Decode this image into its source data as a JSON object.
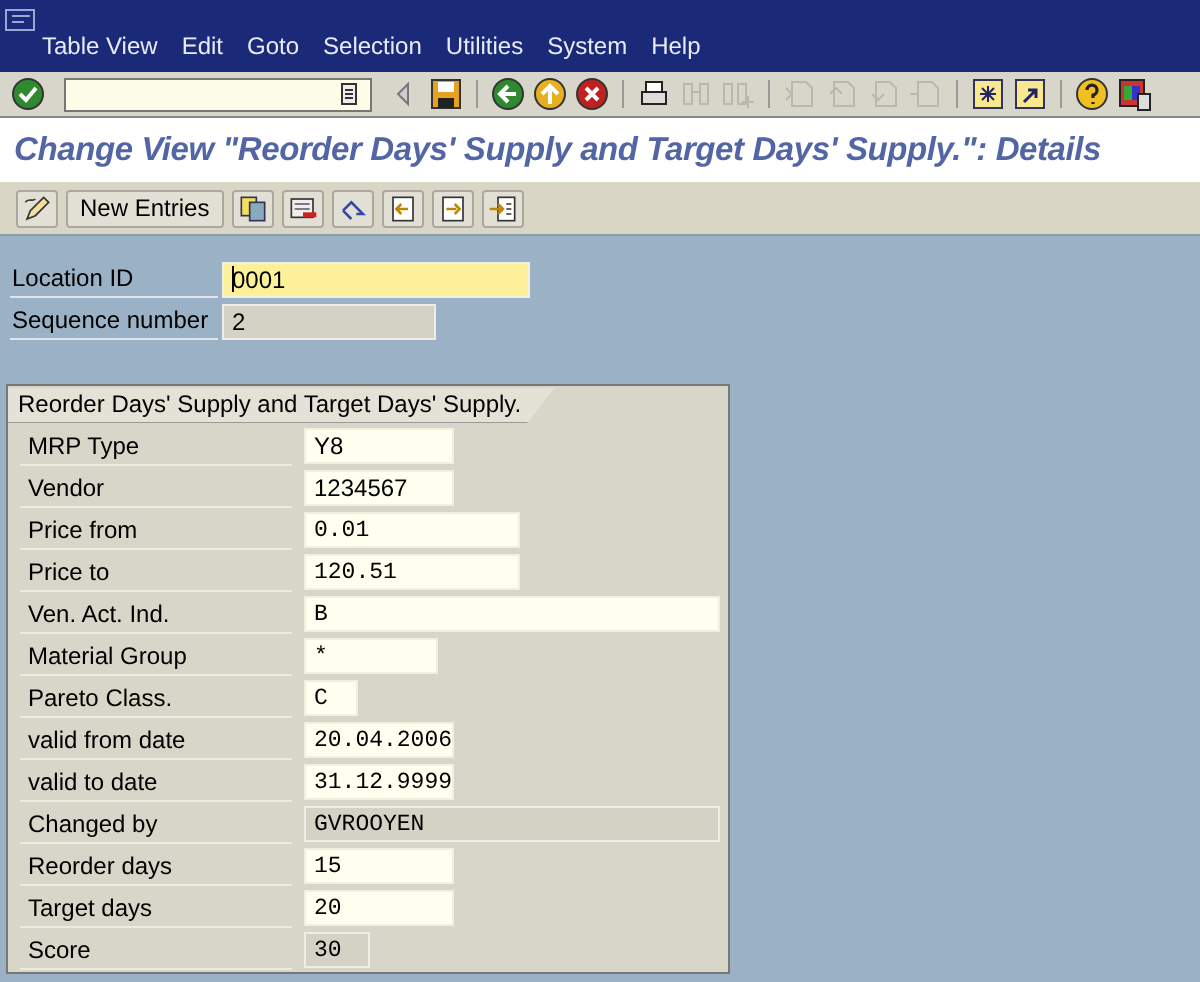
{
  "menu_bar": {
    "items": [
      "Table View",
      "Edit",
      "Goto",
      "Selection",
      "Utilities",
      "System",
      "Help"
    ]
  },
  "title": "Change View \"Reorder Days' Supply and Target Days' Supply.\": Details",
  "app_toolbar": {
    "button": "New Entries"
  },
  "key_fields": [
    {
      "label": "Location ID",
      "value": "0001",
      "kind": "input",
      "focused": true
    },
    {
      "label": "Sequence number",
      "value": "2",
      "kind": "display",
      "focused": false
    }
  ],
  "group": {
    "title": "Reorder Days' Supply and Target Days' Supply.",
    "fields": [
      {
        "label": "MRP Type",
        "value": "Y8",
        "kind": "input"
      },
      {
        "label": "Vendor",
        "value": "1234567",
        "kind": "input"
      },
      {
        "label": "Price from",
        "value": "0.01",
        "kind": "input"
      },
      {
        "label": "Price to",
        "value": "120.51",
        "kind": "input"
      },
      {
        "label": "Ven. Act. Ind.",
        "value": "B",
        "kind": "input"
      },
      {
        "label": "Material Group",
        "value": "*",
        "kind": "input"
      },
      {
        "label": "Pareto Class.",
        "value": "C",
        "kind": "input"
      },
      {
        "label": "valid from date",
        "value": "20.04.2006",
        "kind": "input"
      },
      {
        "label": "valid to date",
        "value": "31.12.9999",
        "kind": "input"
      },
      {
        "label": "Changed by",
        "value": "GVROOYEN",
        "kind": "display"
      },
      {
        "label": "Reorder days",
        "value": "15",
        "kind": "input"
      },
      {
        "label": "Target days",
        "value": "20",
        "kind": "input"
      },
      {
        "label": "Score",
        "value": "30",
        "kind": "display"
      }
    ]
  }
}
